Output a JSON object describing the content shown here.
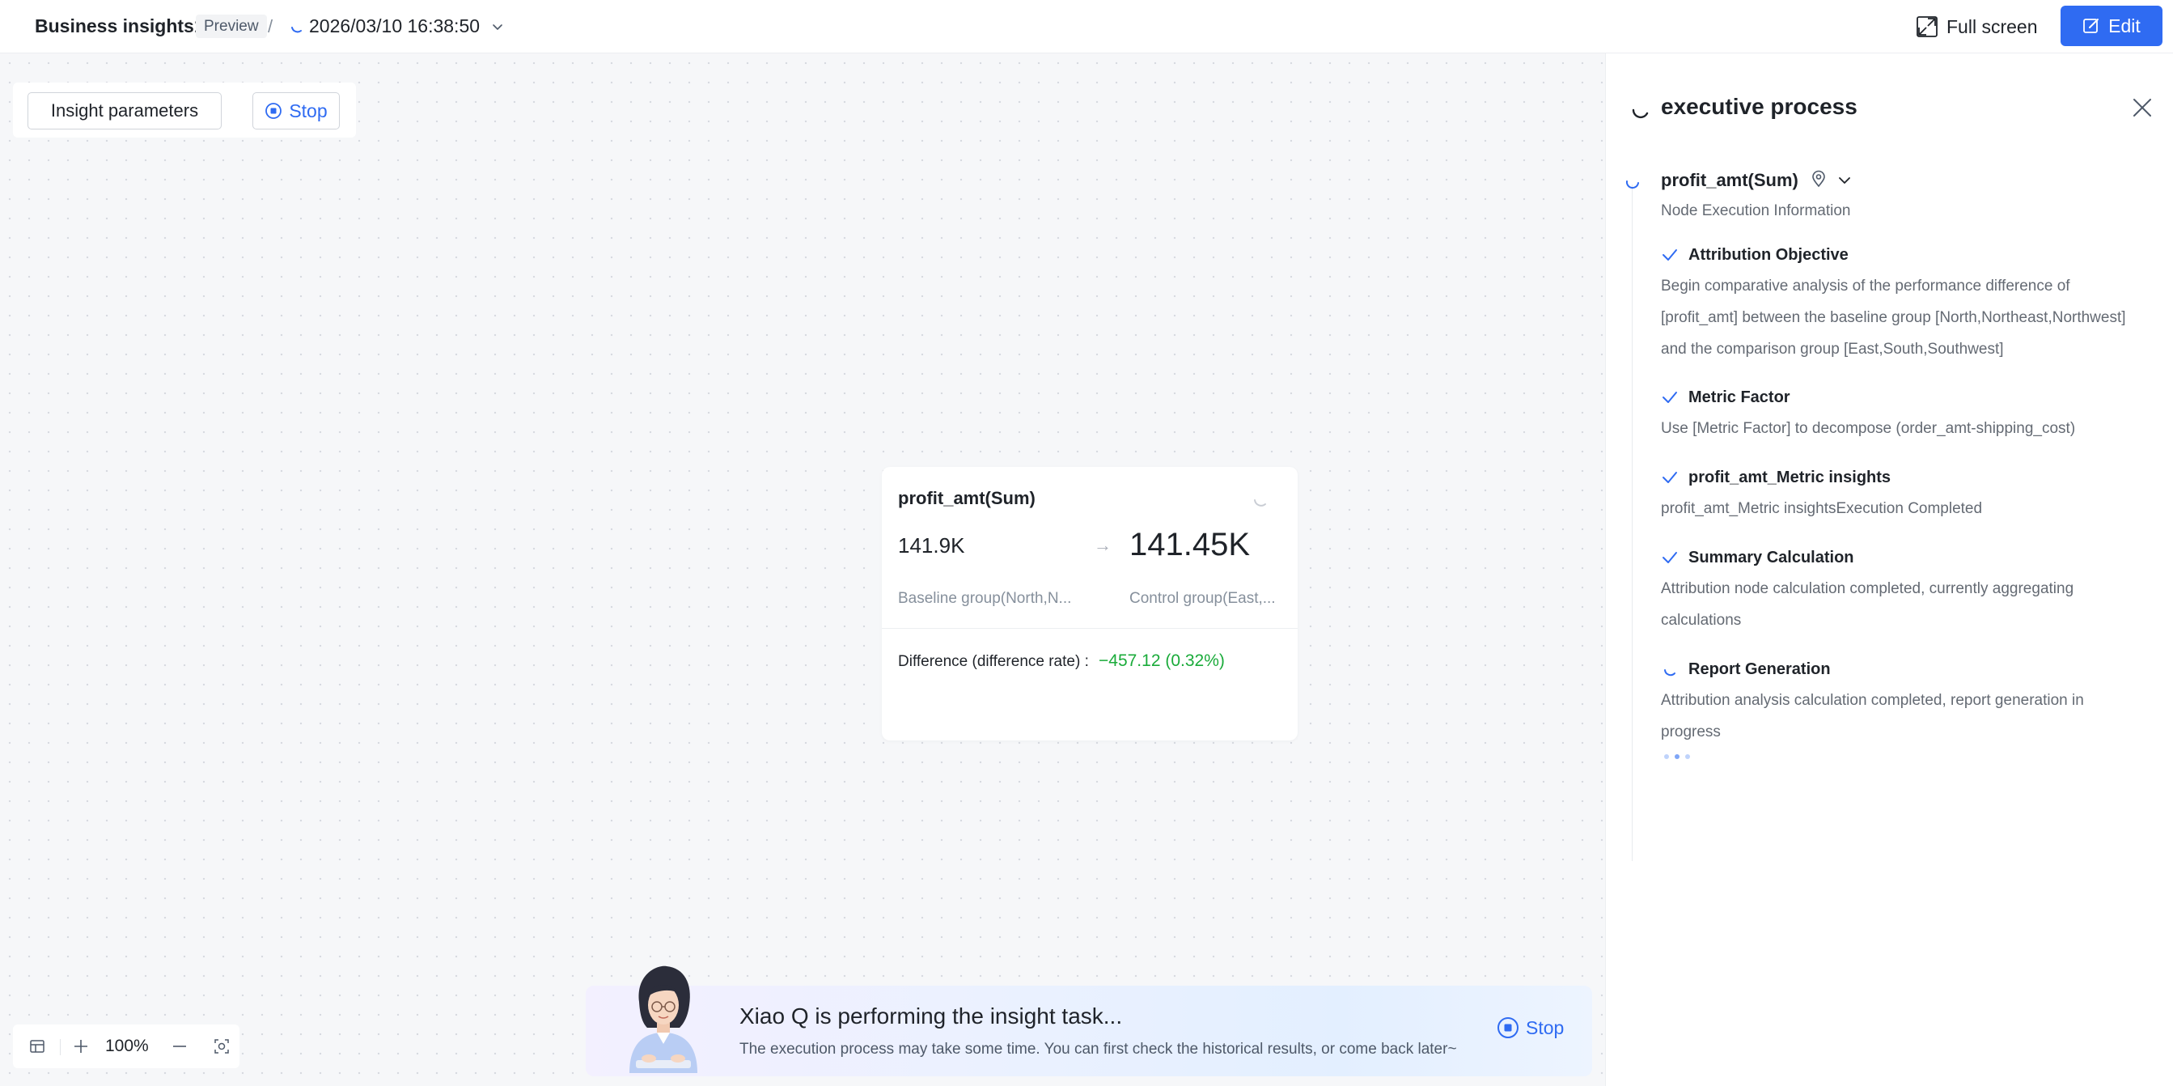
{
  "header": {
    "title": "Business insights1",
    "badge": "Preview",
    "separator": "/",
    "datetime": "2026/03/10 16:38:50",
    "fullscreen_label": "Full screen",
    "edit_label": "Edit"
  },
  "toolbar": {
    "params_label": "Insight parameters",
    "stop_label": "Stop"
  },
  "card": {
    "title": "profit_amt(Sum)",
    "baseline_value": "141.9K",
    "arrow": "→",
    "control_value": "141.45K",
    "baseline_label": "Baseline group(North,N...",
    "control_label": "Control group(East,...",
    "diff_label": "Difference (difference rate) :",
    "diff_value": "−457.12 (0.32%)"
  },
  "zoom": {
    "percent": "100%"
  },
  "notice": {
    "title": "Xiao Q is performing the insight task...",
    "subtitle": "The execution process may take some time. You can first check the historical results, or come back later~",
    "stop_label": "Stop"
  },
  "process": {
    "title": "executive process",
    "node_title": "profit_amt(Sum)",
    "node_info": "Node Execution Information",
    "steps": [
      {
        "title": "Attribution Objective",
        "desc": "Begin comparative analysis of the performance difference of [profit_amt] between the baseline group [North,Northeast,Northwest] and the comparison group [East,South,Southwest]",
        "status": "done"
      },
      {
        "title": "Metric Factor",
        "desc": "Use [Metric Factor] to decompose (order_amt-shipping_cost)",
        "status": "done"
      },
      {
        "title": "profit_amt_Metric insights",
        "desc": "profit_amt_Metric insightsExecution Completed",
        "status": "done"
      },
      {
        "title": "Summary Calculation",
        "desc": "Attribution node calculation completed, currently aggregating calculations",
        "status": "done"
      },
      {
        "title": "Report Generation",
        "desc": "Attribution analysis calculation completed, report generation in progress",
        "status": "running"
      }
    ]
  },
  "colors": {
    "accent": "#2f6bf2",
    "positive": "#1aab3a",
    "text": "#1f2329",
    "muted": "#646a73"
  }
}
